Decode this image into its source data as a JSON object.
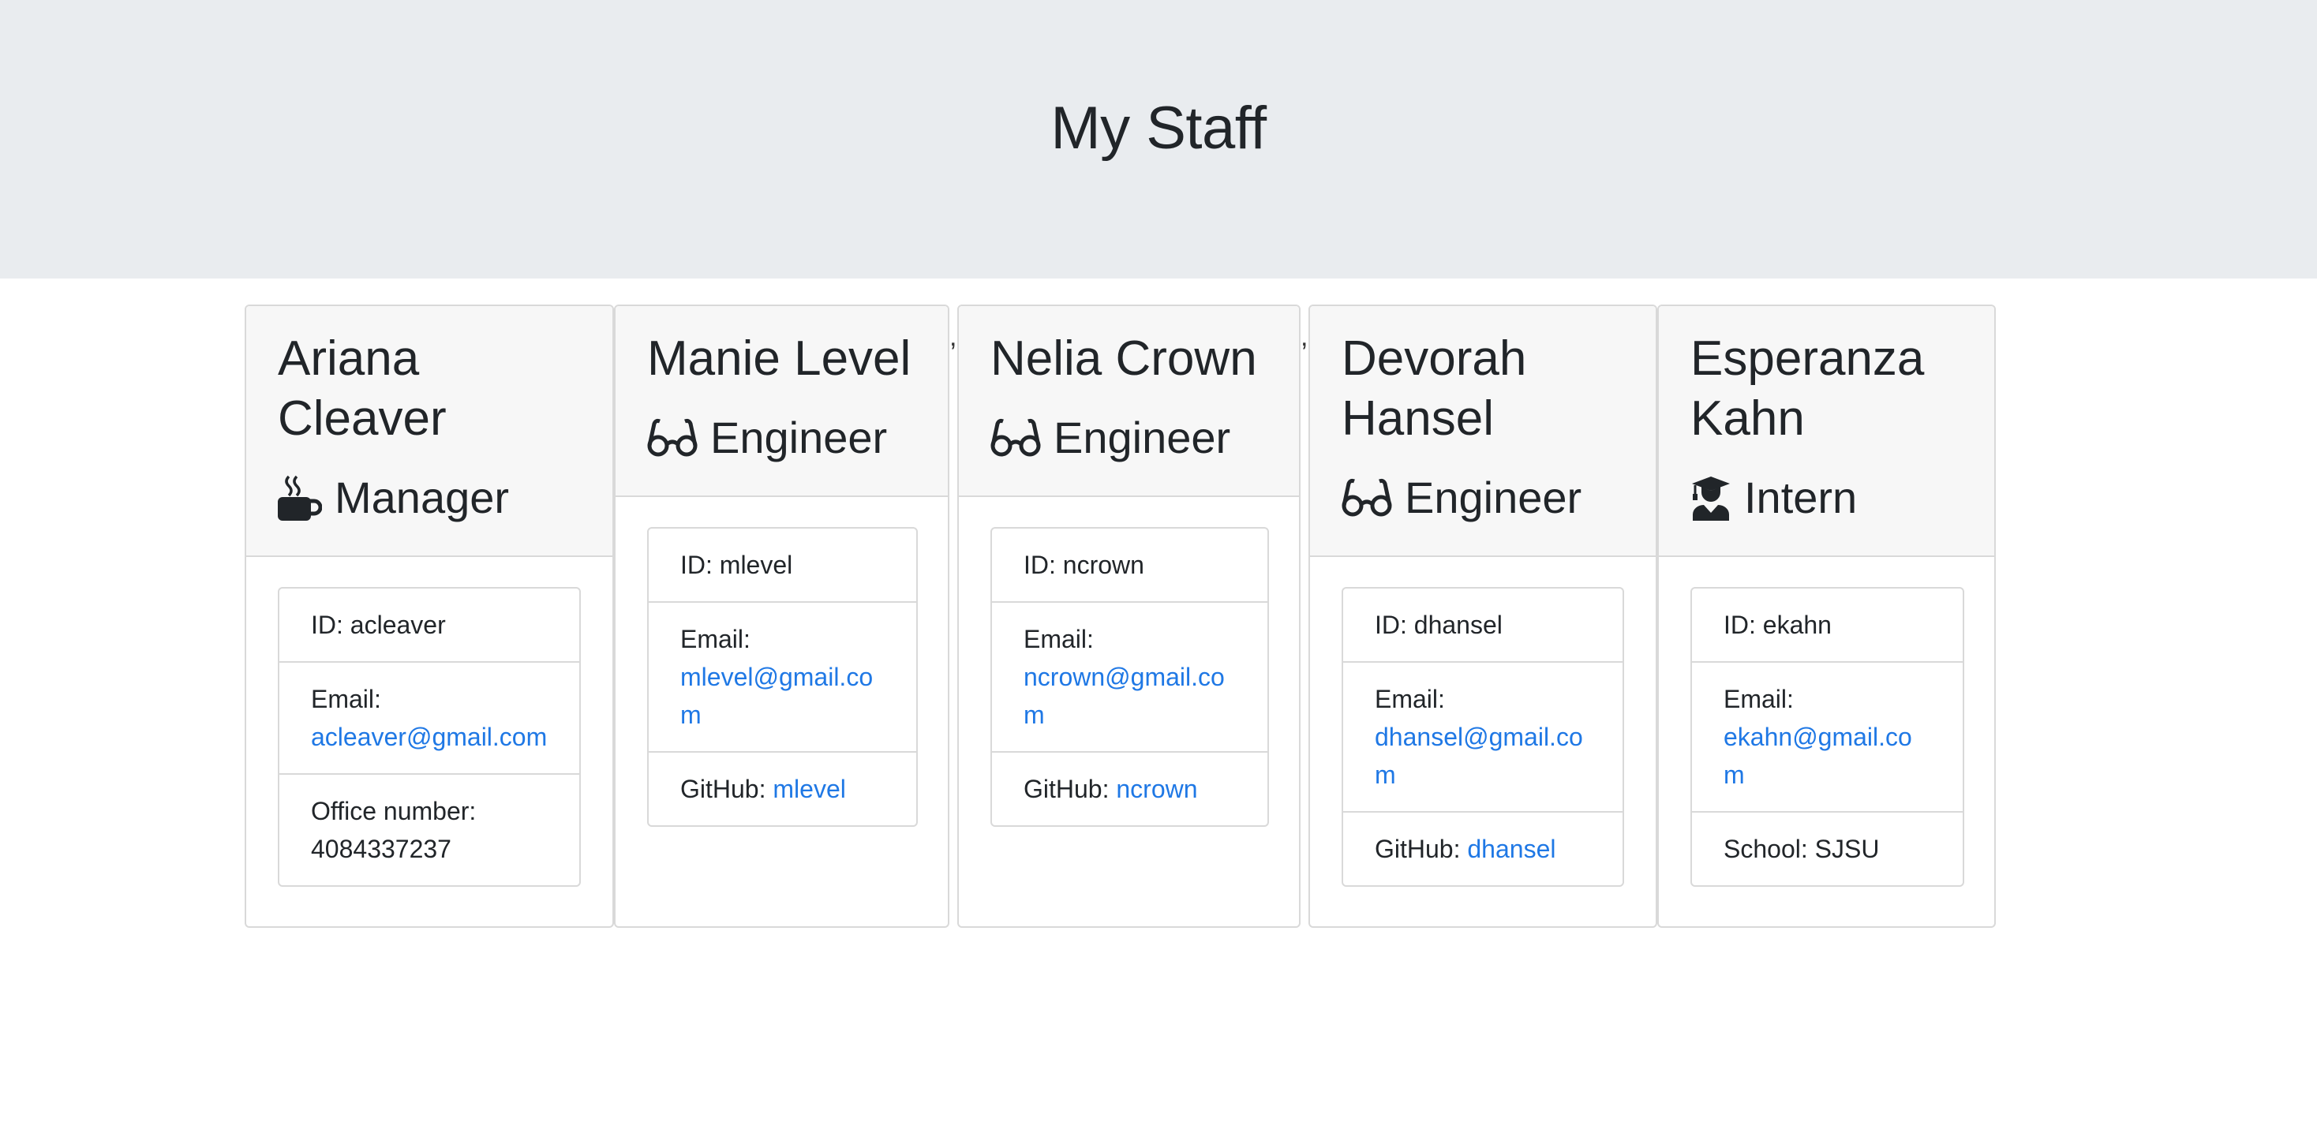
{
  "page": {
    "title": "My Staff"
  },
  "employees": [
    {
      "name": "Ariana Cleaver",
      "role": "Manager",
      "icon": "coffee-icon",
      "id_label": "ID: acleaver",
      "email_label": "Email:",
      "email": "acleaver@gmail.com",
      "extra_label": "Office number:",
      "extra_value": "4084337237"
    },
    {
      "name": "Manie Level",
      "role": "Engineer",
      "icon": "glasses-icon",
      "id_label": "ID: mlevel",
      "email_label": "Email:",
      "email": "mlevel@gmail.com",
      "extra_label": "GitHub:",
      "extra_value": "mlevel"
    },
    {
      "name": "Nelia Crown",
      "role": "Engineer",
      "icon": "glasses-icon",
      "id_label": "ID: ncrown",
      "email_label": "Email:",
      "email": "ncrown@gmail.com",
      "extra_label": "GitHub:",
      "extra_value": "ncrown"
    },
    {
      "name": "Devorah Hansel",
      "role": "Engineer",
      "icon": "glasses-icon",
      "id_label": "ID: dhansel",
      "email_label": "Email:",
      "email": "dhansel@gmail.com",
      "extra_label": "GitHub:",
      "extra_value": "dhansel"
    },
    {
      "name": "Esperanza Kahn",
      "role": "Intern",
      "icon": "graduation-cap-icon",
      "id_label": "ID: ekahn",
      "email_label": "Email:",
      "email": "ekahn@gmail.com",
      "extra_label": "School: SJSU",
      "extra_value": ""
    }
  ],
  "separators": [
    ",",
    ","
  ],
  "colors": {
    "header_bg": "#e9ecef",
    "card_header_bg": "#f7f7f7",
    "link": "#1f78e5",
    "border": "#d9d9d9"
  }
}
